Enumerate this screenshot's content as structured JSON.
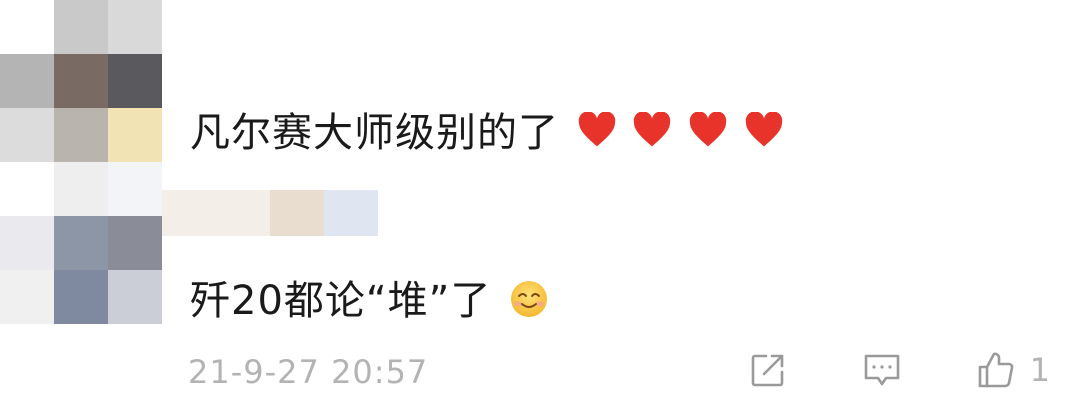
{
  "comments": [
    {
      "text": "凡尔赛大师级别的了",
      "reaction": "heart-icon ×4"
    },
    {
      "text": "歼20都论“堆”了",
      "reaction": "smiling-face-icon"
    }
  ],
  "timestamp": "21-9-27 20:57",
  "actions": {
    "share_icon": "share-icon",
    "reply_icon": "comment-icon",
    "like_icon": "thumbs-up-icon",
    "like_count": "1"
  },
  "colors": {
    "heart": "#e8332a",
    "meta_gray": "#b3b3b3"
  }
}
